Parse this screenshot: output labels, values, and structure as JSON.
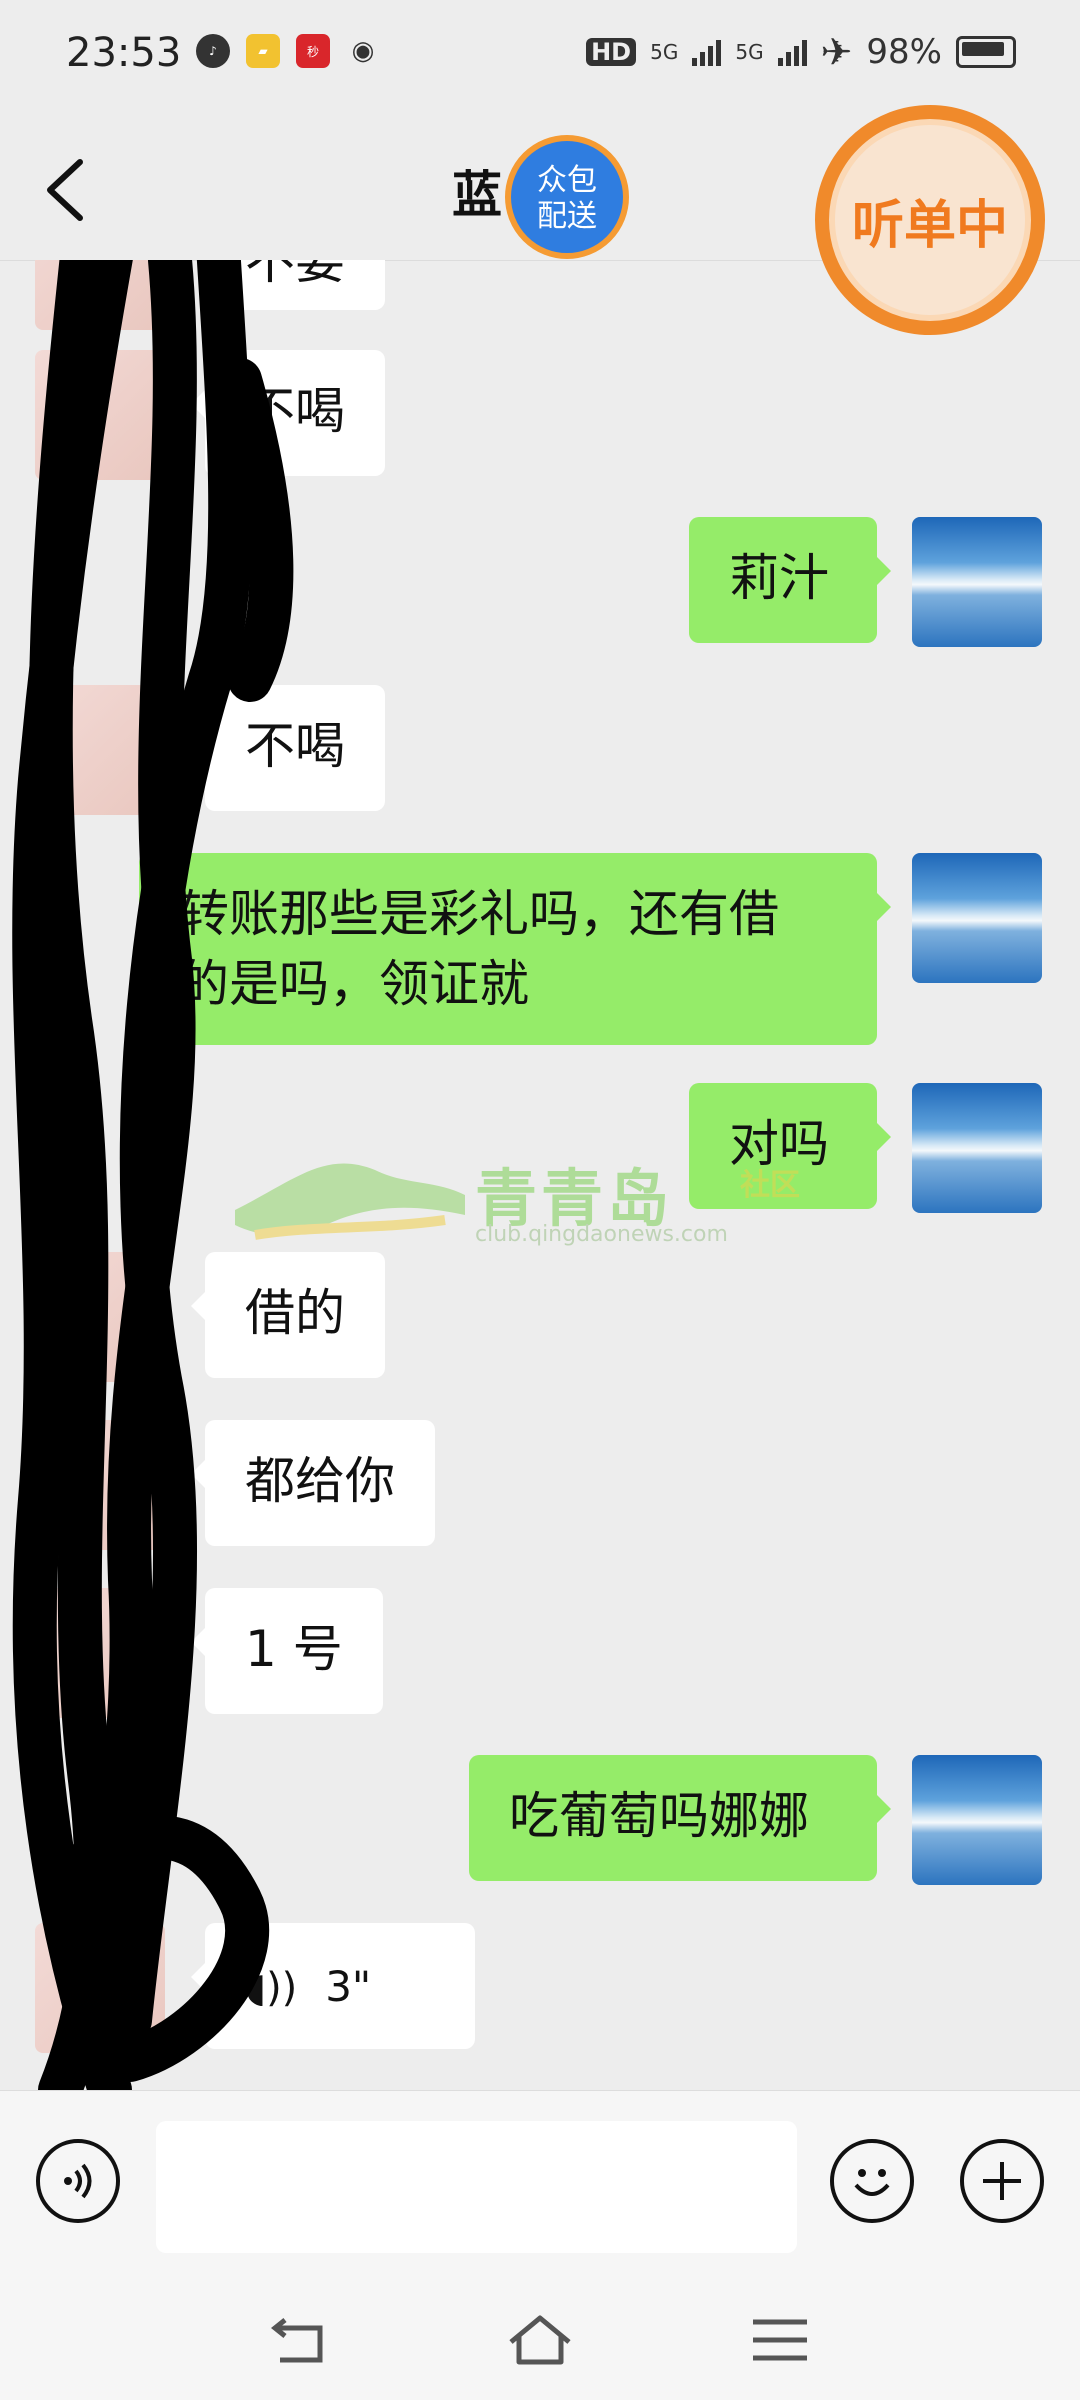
{
  "status_bar": {
    "time": "23:53",
    "network_1": "5G",
    "network_2": "5G",
    "hd_label": "HD",
    "battery_percent": "98%"
  },
  "header": {
    "title": "蓝",
    "badge_delivery": "众包\n配送",
    "badge_listen": "听单中"
  },
  "messages": [
    {
      "side": "left",
      "text": "不要"
    },
    {
      "side": "left",
      "text": "不喝"
    },
    {
      "side": "right",
      "text": "莉汁"
    },
    {
      "side": "left",
      "text": "不喝"
    },
    {
      "side": "right",
      "text_line1": "转账那些是彩礼吗，还有借",
      "text_line2": "的是吗，领证就"
    },
    {
      "side": "right",
      "text": "对吗"
    },
    {
      "side": "left",
      "text": "借的"
    },
    {
      "side": "left",
      "text": "都给你"
    },
    {
      "side": "left",
      "text": "1 号"
    },
    {
      "side": "right",
      "text": "吃葡萄吗娜娜"
    },
    {
      "side": "left",
      "voice_duration": "3\""
    }
  ],
  "watermark": {
    "name": "青青岛",
    "tag": "社区",
    "url": "club.qingdaonews.com"
  },
  "input": {
    "placeholder": ""
  },
  "colors": {
    "background": "#ededed",
    "bubble_sent": "#95ec69",
    "bubble_received": "#ffffff",
    "accent_orange": "#f08a2b",
    "badge_blue": "#2f7de0"
  },
  "icons": [
    "back-arrow-icon",
    "voice-input-icon",
    "emoji-icon",
    "plus-icon",
    "nav-back-icon",
    "nav-home-icon",
    "nav-menu-icon"
  ]
}
